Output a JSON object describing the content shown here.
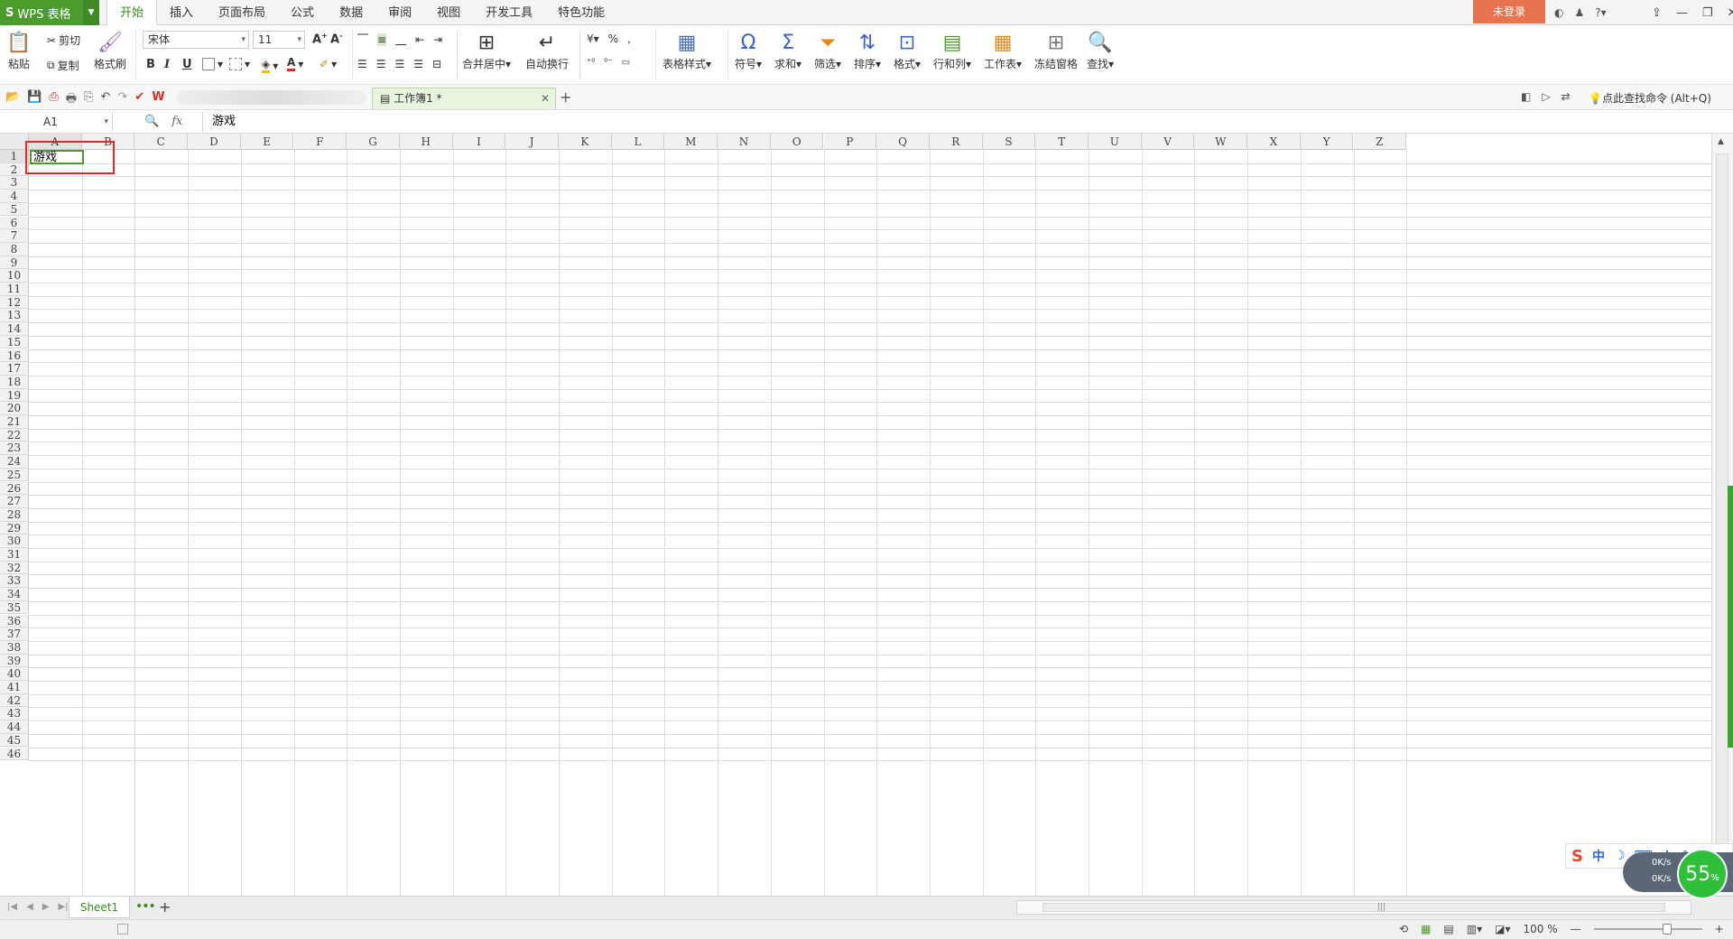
{
  "app": {
    "name": "WPS 表格",
    "logo": "S"
  },
  "menu": {
    "tabs": [
      "开始",
      "插入",
      "页面布局",
      "公式",
      "数据",
      "审阅",
      "视图",
      "开发工具",
      "特色功能"
    ],
    "login": "未登录"
  },
  "ribbon": {
    "paste": "粘贴",
    "cut": "剪切",
    "copy": "复制",
    "format_painter": "格式刷",
    "font_name": "宋体",
    "font_size": "11",
    "bold": "B",
    "italic": "I",
    "underline": "U",
    "merge_center": "合并居中",
    "wrap_text": "自动换行",
    "percent": "%",
    "comma": ",",
    "table_style": "表格样式",
    "symbol": "符号",
    "sum": "求和",
    "filter": "筛选",
    "sort": "排序",
    "format": "格式",
    "row_col": "行和列",
    "worksheet": "工作表",
    "freeze": "冻结窗格",
    "find": "查找"
  },
  "doc": {
    "tab": "工作簿1 *",
    "find_command": "点此查找命令 (Alt+Q)"
  },
  "formula_bar": {
    "name_box": "A1",
    "fx": "fx",
    "content": "游戏"
  },
  "grid": {
    "columns": [
      "A",
      "B",
      "C",
      "D",
      "E",
      "F",
      "G",
      "H",
      "I",
      "J",
      "K",
      "L",
      "M",
      "N",
      "O",
      "P",
      "Q",
      "R",
      "S",
      "T",
      "U",
      "V",
      "W",
      "X",
      "Y",
      "Z"
    ],
    "rows": 46,
    "cell_A1": "游戏"
  },
  "sheets": {
    "active": "Sheet1"
  },
  "status": {
    "zoom": "100 %"
  },
  "widget": {
    "up": "0K/s",
    "down": "0K/s",
    "percent": "55",
    "percent_sign": "%"
  },
  "ime": {
    "lang": "中"
  },
  "colors": {
    "accent": "#4a9c2d",
    "login": "#e8734f",
    "highlight": "#e02a2a"
  }
}
